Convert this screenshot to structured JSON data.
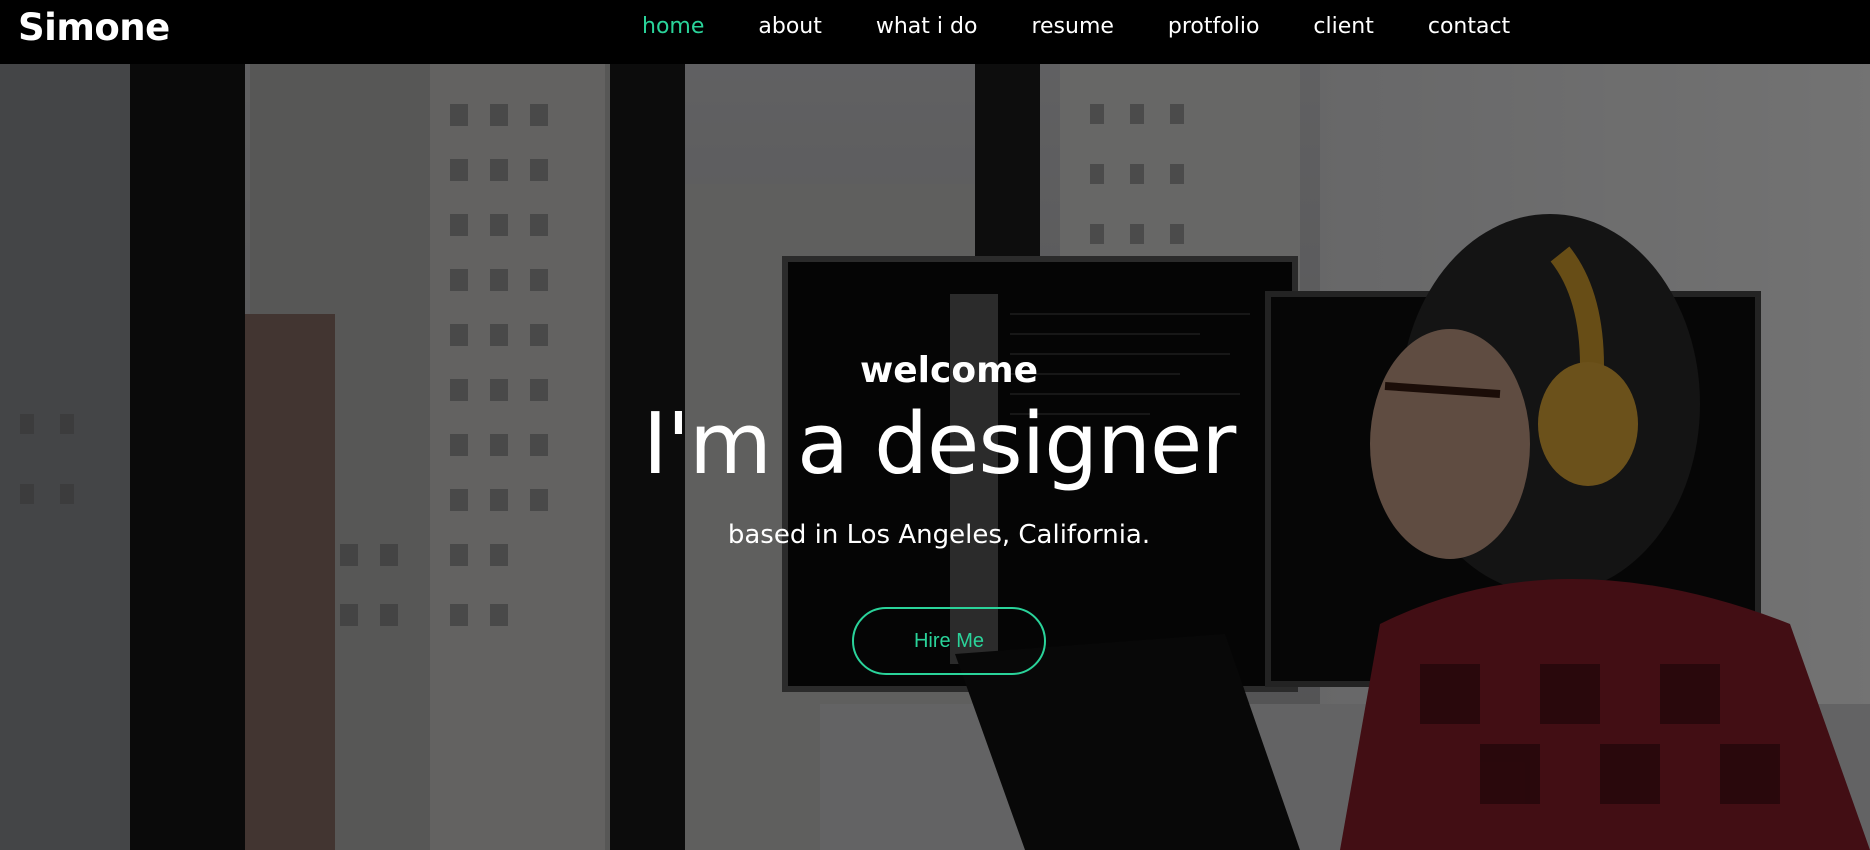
{
  "brand": "Simone",
  "nav": {
    "items": [
      {
        "label": "home",
        "active": true
      },
      {
        "label": "about",
        "active": false
      },
      {
        "label": "what i do",
        "active": false
      },
      {
        "label": "resume",
        "active": false
      },
      {
        "label": "protfolio",
        "active": false
      },
      {
        "label": "client",
        "active": false
      },
      {
        "label": "contact",
        "active": false
      }
    ]
  },
  "hero": {
    "welcome": "welcome",
    "headline": "I'm a designer",
    "subline": "based in Los Angeles, California.",
    "cta_label": "Hire Me"
  },
  "colors": {
    "accent": "#2ad39a",
    "navbar_bg": "#000000",
    "text": "#ffffff"
  },
  "icons": []
}
